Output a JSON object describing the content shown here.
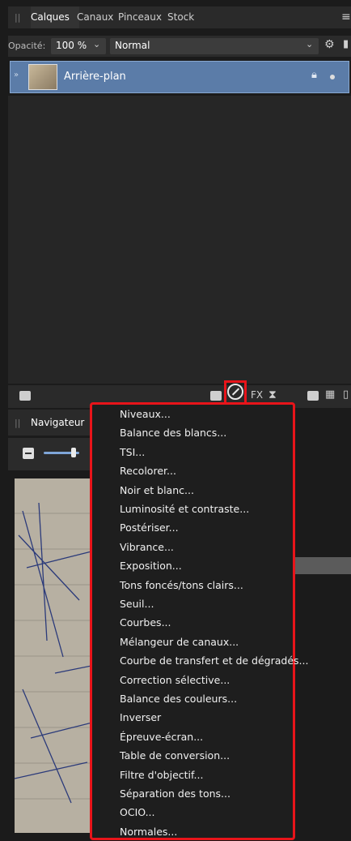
{
  "top_tabs": [
    "Calques",
    "Canaux",
    "Pinceaux",
    "Stock"
  ],
  "opacity": {
    "label": "Opacité:",
    "value": "100 %"
  },
  "blend_mode": "Normal",
  "layer": {
    "name": "Arrière-plan"
  },
  "navigator": {
    "tab": "Navigateur"
  },
  "fx_label": "FX",
  "menu_items": [
    "Niveaux...",
    "Balance des blancs...",
    "TSI...",
    "Recolorer...",
    "Noir et blanc...",
    "Luminosité et contraste...",
    "Postériser...",
    "Vibrance...",
    "Exposition...",
    "Tons foncés/tons clairs...",
    "Seuil...",
    "Courbes...",
    "Mélangeur de canaux...",
    "Courbe de transfert et de dégradés...",
    "Correction sélective...",
    "Balance des couleurs...",
    "Inverser",
    "Épreuve-écran...",
    "Table de conversion...",
    "Filtre d'objectif...",
    "Séparation des tons...",
    "OCIO...",
    "Normales..."
  ],
  "highlighted_index": 8,
  "colors": {
    "accent_red": "#e8141a",
    "selection_blue": "#5b7ca8"
  }
}
